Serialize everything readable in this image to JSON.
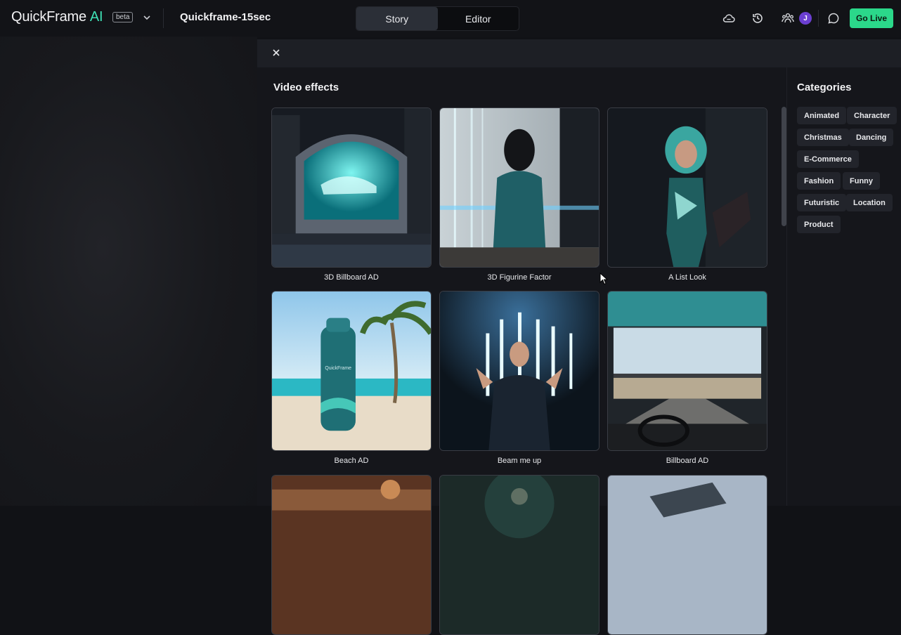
{
  "topbar": {
    "logo": "QuickFrame",
    "logo_ai": "AI",
    "beta": "beta",
    "project_title": "Quickframe-15sec",
    "tabs": [
      {
        "label": "Story",
        "active": true
      },
      {
        "label": "Editor",
        "active": false
      }
    ],
    "avatar_initial": "J",
    "go_live": "Go Live",
    "accent": "#2bd88a"
  },
  "effects": {
    "title": "Video effects",
    "items": [
      {
        "label": "3D Billboard AD"
      },
      {
        "label": "3D Figurine Factor"
      },
      {
        "label": "A List Look"
      },
      {
        "label": "Beach AD"
      },
      {
        "label": "Beam me up"
      },
      {
        "label": "Billboard AD"
      },
      {
        "label": ""
      },
      {
        "label": ""
      },
      {
        "label": ""
      }
    ]
  },
  "categories": {
    "title": "Categories",
    "chips": [
      "Animated",
      "Character",
      "Christmas",
      "Dancing",
      "E-Commerce",
      "Fashion",
      "Funny",
      "Futuristic",
      "Location",
      "Product"
    ]
  },
  "thumb_texts": {
    "bottle_brand": "QuickFrame"
  }
}
